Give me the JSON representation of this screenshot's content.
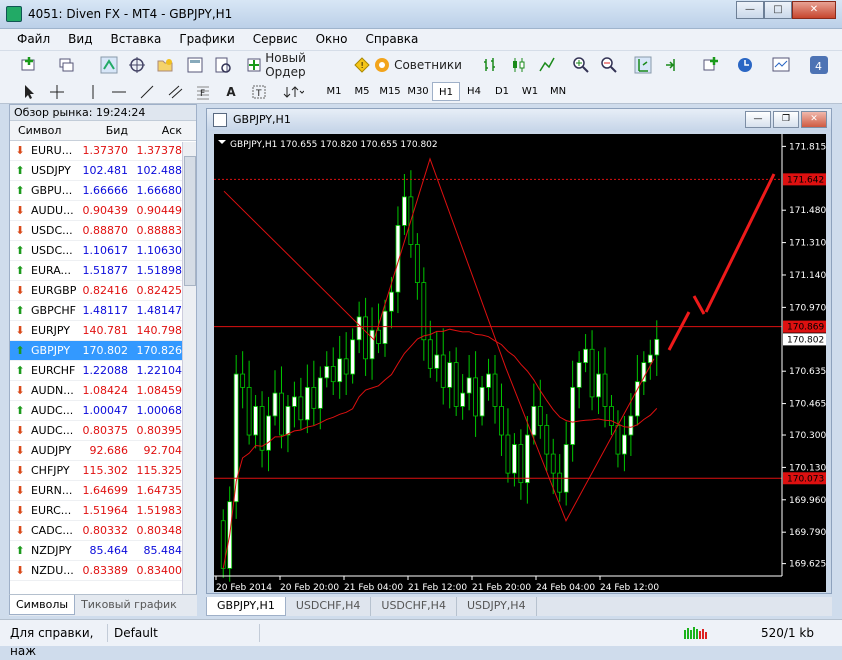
{
  "window": {
    "title": "4051: Diven FX - MT4 - GBPJPY,H1"
  },
  "menu": [
    "Файл",
    "Вид",
    "Вставка",
    "Графики",
    "Сервис",
    "Окно",
    "Справка"
  ],
  "toolbar": {
    "new_order": "Новый Ордер",
    "advisors": "Советники"
  },
  "timeframes": [
    {
      "label": "M1",
      "active": false
    },
    {
      "label": "M5",
      "active": false
    },
    {
      "label": "M15",
      "active": false
    },
    {
      "label": "M30",
      "active": false
    },
    {
      "label": "H1",
      "active": true
    },
    {
      "label": "H4",
      "active": false
    },
    {
      "label": "D1",
      "active": false
    },
    {
      "label": "W1",
      "active": false
    },
    {
      "label": "MN",
      "active": false
    }
  ],
  "market_watch": {
    "title": "Обзор рынка: 19:24:24",
    "headers": {
      "symbol": "Символ",
      "bid": "Бид",
      "ask": "Аск"
    },
    "rows": [
      {
        "symbol": "EURU...",
        "bid": "1.37370",
        "ask": "1.37378",
        "dir": "down",
        "selected": false
      },
      {
        "symbol": "USDJPY",
        "bid": "102.481",
        "ask": "102.488",
        "dir": "up",
        "selected": false
      },
      {
        "symbol": "GBPU...",
        "bid": "1.66666",
        "ask": "1.66680",
        "dir": "up",
        "selected": false
      },
      {
        "symbol": "AUDU...",
        "bid": "0.90439",
        "ask": "0.90449",
        "dir": "down",
        "selected": false
      },
      {
        "symbol": "USDC...",
        "bid": "0.88870",
        "ask": "0.88883",
        "dir": "down",
        "selected": false
      },
      {
        "symbol": "USDC...",
        "bid": "1.10617",
        "ask": "1.10630",
        "dir": "up",
        "selected": false
      },
      {
        "symbol": "EURA...",
        "bid": "1.51877",
        "ask": "1.51898",
        "dir": "up",
        "selected": false
      },
      {
        "symbol": "EURGBP",
        "bid": "0.82416",
        "ask": "0.82425",
        "dir": "down",
        "selected": false
      },
      {
        "symbol": "GBPCHF",
        "bid": "1.48117",
        "ask": "1.48147",
        "dir": "up",
        "selected": false
      },
      {
        "symbol": "EURJPY",
        "bid": "140.781",
        "ask": "140.798",
        "dir": "down",
        "selected": false
      },
      {
        "symbol": "GBPJPY",
        "bid": "170.802",
        "ask": "170.826",
        "dir": "up",
        "selected": true
      },
      {
        "symbol": "EURCHF",
        "bid": "1.22088",
        "ask": "1.22104",
        "dir": "up",
        "selected": false
      },
      {
        "symbol": "AUDN...",
        "bid": "1.08424",
        "ask": "1.08459",
        "dir": "down",
        "selected": false
      },
      {
        "symbol": "AUDC...",
        "bid": "1.00047",
        "ask": "1.00068",
        "dir": "up",
        "selected": false
      },
      {
        "symbol": "AUDC...",
        "bid": "0.80375",
        "ask": "0.80395",
        "dir": "down",
        "selected": false
      },
      {
        "symbol": "AUDJPY",
        "bid": "92.686",
        "ask": "92.704",
        "dir": "down",
        "selected": false
      },
      {
        "symbol": "CHFJPY",
        "bid": "115.302",
        "ask": "115.325",
        "dir": "down",
        "selected": false
      },
      {
        "symbol": "EURN...",
        "bid": "1.64699",
        "ask": "1.64735",
        "dir": "down",
        "selected": false
      },
      {
        "symbol": "EURC...",
        "bid": "1.51964",
        "ask": "1.51983",
        "dir": "down",
        "selected": false
      },
      {
        "symbol": "CADC...",
        "bid": "0.80332",
        "ask": "0.80348",
        "dir": "down",
        "selected": false
      },
      {
        "symbol": "NZDJPY",
        "bid": "85.464",
        "ask": "85.484",
        "dir": "up",
        "selected": false
      },
      {
        "symbol": "NZDU...",
        "bid": "0.83389",
        "ask": "0.83400",
        "dir": "down",
        "selected": false
      }
    ],
    "tabs": [
      "Символы",
      "Тиковый график"
    ]
  },
  "chart_window": {
    "title": "GBPJPY,H1",
    "info": "GBPJPY,H1  170.655 170.820 170.655 170.802"
  },
  "chart_data": {
    "type": "candlestick",
    "symbol": "GBPJPY,H1",
    "ylim": [
      169.56,
      171.88
    ],
    "y_ticks": [
      "171.815",
      "171.480",
      "171.310",
      "171.140",
      "170.970",
      "170.635",
      "170.465",
      "170.300",
      "170.130",
      "169.960",
      "169.790",
      "169.625"
    ],
    "x_ticks": [
      "20 Feb 2014",
      "20 Feb 20:00",
      "21 Feb 04:00",
      "21 Feb 12:00",
      "21 Feb 20:00",
      "24 Feb 04:00",
      "24 Feb 12:00"
    ],
    "current_price": "170.802",
    "hlines": [
      {
        "label": "171.642",
        "value": 171.642,
        "style": "dashed"
      },
      {
        "label": "170.869",
        "value": 170.869,
        "style": "solid"
      },
      {
        "label": "170.073",
        "value": 170.073,
        "style": "solid"
      }
    ],
    "colors": {
      "background": "#000000",
      "grid": "#ffffff",
      "bull": "#ffffff",
      "bear": "#000000",
      "candle_edge": "#00c800",
      "line": "#dd1010",
      "label_bg": "#dd1010"
    }
  },
  "chart_tabs": [
    {
      "label": "GBPJPY,H1",
      "active": true
    },
    {
      "label": "USDCHF,H4",
      "active": false
    },
    {
      "label": "USDCHF,H4",
      "active": false
    },
    {
      "label": "USDJPY,H4",
      "active": false
    }
  ],
  "status": {
    "help": "Для справки, наж",
    "profile": "Default",
    "traffic": "520/1 kb"
  }
}
